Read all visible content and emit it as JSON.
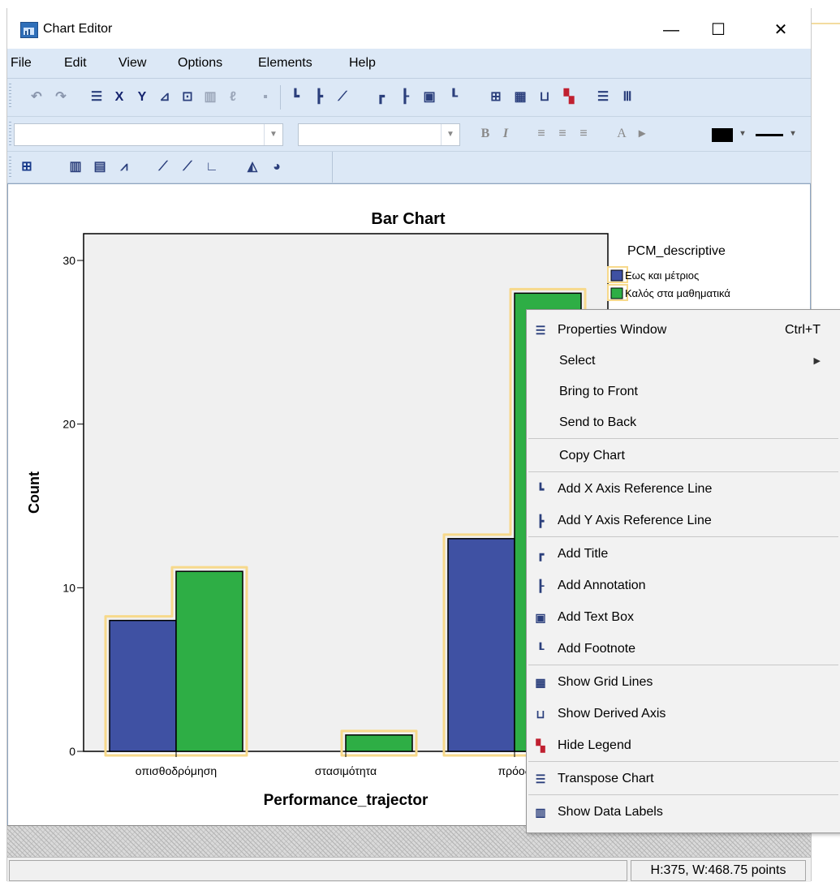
{
  "window": {
    "title": "Chart Editor"
  },
  "menu": [
    "File",
    "Edit",
    "View",
    "Options",
    "Elements",
    "Help"
  ],
  "chart": {
    "title": "Bar Chart",
    "xlabel": "Performance_trajector",
    "ylabel": "Count",
    "legend_title": "PCM_descriptive",
    "legend_items": [
      "Εως και μέτριος",
      "Καλός στα μαθηματικά"
    ]
  },
  "chart_data": {
    "type": "bar",
    "title": "Bar Chart",
    "xlabel": "Performance_trajector",
    "ylabel": "Count",
    "categories": [
      "οπισθοδρόμηση",
      "στασιμότητα",
      "πρόοδ"
    ],
    "series": [
      {
        "name": "Εως και μέτριος",
        "color": "#3f51a3",
        "values": [
          8,
          0,
          13
        ]
      },
      {
        "name": "Καλός στα μαθηματικά",
        "color": "#2eae45",
        "values": [
          11,
          1,
          28
        ]
      }
    ],
    "ylim": [
      0,
      30
    ],
    "yticks": [
      0,
      10,
      20,
      30
    ],
    "legend_position": "right",
    "selection_color": "#f7d98b"
  },
  "context_menu": {
    "items": [
      {
        "label": "Properties Window",
        "shortcut": "Ctrl+T",
        "icon": "properties-icon"
      },
      {
        "label": "Select",
        "submenu": true
      },
      {
        "label": "Bring to Front"
      },
      {
        "label": "Send to Back"
      },
      {
        "label": "Copy Chart"
      },
      {
        "label": "Add X Axis Reference Line",
        "icon": "x-ref-line-icon"
      },
      {
        "label": "Add Y Axis Reference Line",
        "icon": "y-ref-line-icon"
      },
      {
        "label": "Add Title",
        "icon": "title-icon"
      },
      {
        "label": "Add Annotation",
        "icon": "annotation-icon"
      },
      {
        "label": "Add Text Box",
        "icon": "textbox-icon"
      },
      {
        "label": "Add Footnote",
        "icon": "footnote-icon"
      },
      {
        "label": "Show Grid Lines",
        "icon": "grid-icon"
      },
      {
        "label": "Show Derived Axis",
        "icon": "derived-axis-icon"
      },
      {
        "label": "Hide Legend",
        "icon": "legend-icon"
      },
      {
        "label": "Transpose Chart",
        "icon": "transpose-icon"
      },
      {
        "label": "Show Data Labels",
        "icon": "data-labels-icon"
      }
    ]
  },
  "status": {
    "size": "H:375, W:468.75 points"
  },
  "toolbar2": {
    "bold": "B",
    "italic": "I",
    "font_color": "A"
  }
}
